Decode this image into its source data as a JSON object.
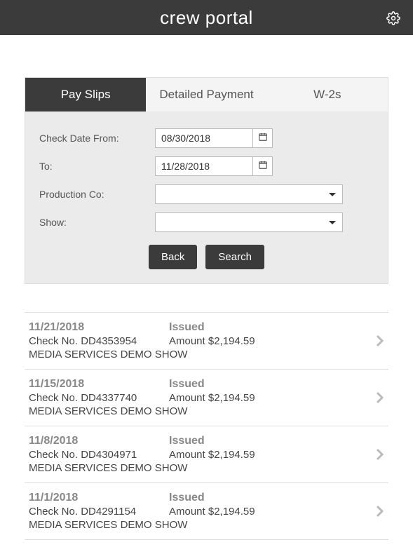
{
  "header": {
    "title": "crew portal"
  },
  "tabs": [
    {
      "label": "Pay Slips",
      "active": true
    },
    {
      "label": "Detailed Payment",
      "active": false
    },
    {
      "label": "W-2s",
      "active": false
    }
  ],
  "filters": {
    "checkDateFrom": {
      "label": "Check Date From:",
      "value": "08/30/2018"
    },
    "to": {
      "label": "To:",
      "value": "11/28/2018"
    },
    "productionCo": {
      "label": "Production Co:",
      "value": ""
    },
    "show": {
      "label": "Show:",
      "value": ""
    }
  },
  "buttons": {
    "back": "Back",
    "search": "Search"
  },
  "labels": {
    "checkNoPrefix": "Check No. ",
    "amountPrefix": "Amount "
  },
  "slips": [
    {
      "date": "11/21/2018",
      "status": "Issued",
      "checkNo": "DD4353954",
      "amount": "$2,194.59",
      "show": "MEDIA SERVICES DEMO SHOW"
    },
    {
      "date": "11/15/2018",
      "status": "Issued",
      "checkNo": "DD4337740",
      "amount": "$2,194.59",
      "show": "MEDIA SERVICES DEMO SHOW"
    },
    {
      "date": "11/8/2018",
      "status": "Issued",
      "checkNo": "DD4304971",
      "amount": "$2,194.59",
      "show": "MEDIA SERVICES DEMO SHOW"
    },
    {
      "date": "11/1/2018",
      "status": "Issued",
      "checkNo": "DD4291154",
      "amount": "$2,194.59",
      "show": "MEDIA SERVICES DEMO SHOW"
    }
  ]
}
